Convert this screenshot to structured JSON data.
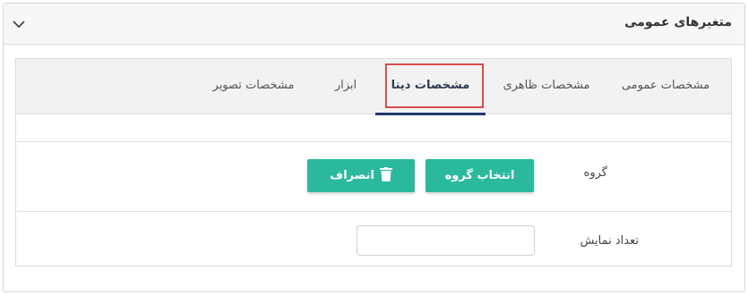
{
  "header": {
    "title": "متغیرهای عمومی",
    "collapse_icon": "chevron-down-icon"
  },
  "tabs": [
    {
      "label": "مشخصات عمومی",
      "active": false
    },
    {
      "label": "مشخصات ظاهری",
      "active": false
    },
    {
      "label": "مشخصات دیتا",
      "active": true
    },
    {
      "label": "ابزار",
      "active": false
    },
    {
      "label": "مشخصات تصویر",
      "active": false
    }
  ],
  "group": {
    "label": "گروه",
    "select_button": "انتخاب گروه",
    "cancel_button": "انصراف",
    "cancel_icon": "trash-icon"
  },
  "display_count": {
    "label": "تعداد نمایش",
    "value": "",
    "placeholder": ""
  },
  "colors": {
    "accent": "#2bb99e",
    "active_tab_underline": "#1f3a6e",
    "highlight": "#e04a4a"
  }
}
